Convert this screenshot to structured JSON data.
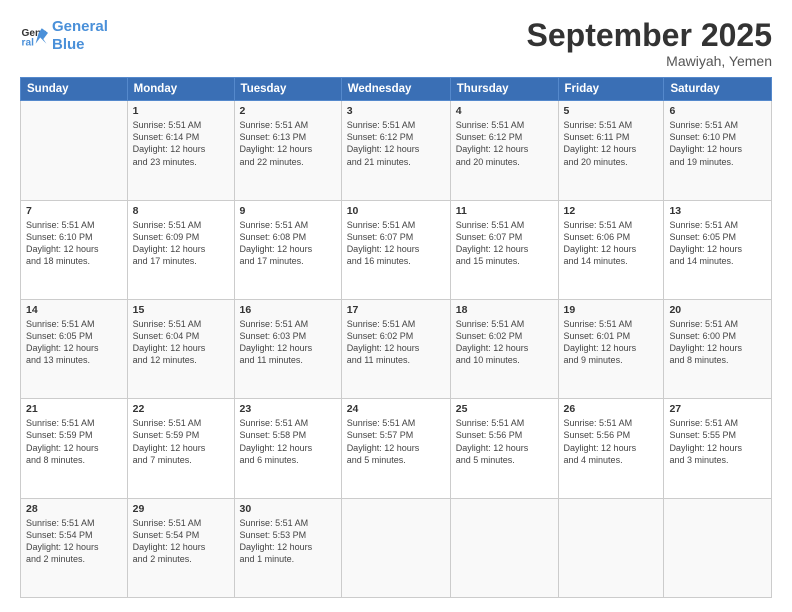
{
  "header": {
    "logo_line1": "General",
    "logo_line2": "Blue",
    "title": "September 2025",
    "subtitle": "Mawiyah, Yemen"
  },
  "columns": [
    "Sunday",
    "Monday",
    "Tuesday",
    "Wednesday",
    "Thursday",
    "Friday",
    "Saturday"
  ],
  "weeks": [
    [
      {
        "day": "",
        "content": ""
      },
      {
        "day": "1",
        "content": "Sunrise: 5:51 AM\nSunset: 6:14 PM\nDaylight: 12 hours\nand 23 minutes."
      },
      {
        "day": "2",
        "content": "Sunrise: 5:51 AM\nSunset: 6:13 PM\nDaylight: 12 hours\nand 22 minutes."
      },
      {
        "day": "3",
        "content": "Sunrise: 5:51 AM\nSunset: 6:12 PM\nDaylight: 12 hours\nand 21 minutes."
      },
      {
        "day": "4",
        "content": "Sunrise: 5:51 AM\nSunset: 6:12 PM\nDaylight: 12 hours\nand 20 minutes."
      },
      {
        "day": "5",
        "content": "Sunrise: 5:51 AM\nSunset: 6:11 PM\nDaylight: 12 hours\nand 20 minutes."
      },
      {
        "day": "6",
        "content": "Sunrise: 5:51 AM\nSunset: 6:10 PM\nDaylight: 12 hours\nand 19 minutes."
      }
    ],
    [
      {
        "day": "7",
        "content": "Sunrise: 5:51 AM\nSunset: 6:10 PM\nDaylight: 12 hours\nand 18 minutes."
      },
      {
        "day": "8",
        "content": "Sunrise: 5:51 AM\nSunset: 6:09 PM\nDaylight: 12 hours\nand 17 minutes."
      },
      {
        "day": "9",
        "content": "Sunrise: 5:51 AM\nSunset: 6:08 PM\nDaylight: 12 hours\nand 17 minutes."
      },
      {
        "day": "10",
        "content": "Sunrise: 5:51 AM\nSunset: 6:07 PM\nDaylight: 12 hours\nand 16 minutes."
      },
      {
        "day": "11",
        "content": "Sunrise: 5:51 AM\nSunset: 6:07 PM\nDaylight: 12 hours\nand 15 minutes."
      },
      {
        "day": "12",
        "content": "Sunrise: 5:51 AM\nSunset: 6:06 PM\nDaylight: 12 hours\nand 14 minutes."
      },
      {
        "day": "13",
        "content": "Sunrise: 5:51 AM\nSunset: 6:05 PM\nDaylight: 12 hours\nand 14 minutes."
      }
    ],
    [
      {
        "day": "14",
        "content": "Sunrise: 5:51 AM\nSunset: 6:05 PM\nDaylight: 12 hours\nand 13 minutes."
      },
      {
        "day": "15",
        "content": "Sunrise: 5:51 AM\nSunset: 6:04 PM\nDaylight: 12 hours\nand 12 minutes."
      },
      {
        "day": "16",
        "content": "Sunrise: 5:51 AM\nSunset: 6:03 PM\nDaylight: 12 hours\nand 11 minutes."
      },
      {
        "day": "17",
        "content": "Sunrise: 5:51 AM\nSunset: 6:02 PM\nDaylight: 12 hours\nand 11 minutes."
      },
      {
        "day": "18",
        "content": "Sunrise: 5:51 AM\nSunset: 6:02 PM\nDaylight: 12 hours\nand 10 minutes."
      },
      {
        "day": "19",
        "content": "Sunrise: 5:51 AM\nSunset: 6:01 PM\nDaylight: 12 hours\nand 9 minutes."
      },
      {
        "day": "20",
        "content": "Sunrise: 5:51 AM\nSunset: 6:00 PM\nDaylight: 12 hours\nand 8 minutes."
      }
    ],
    [
      {
        "day": "21",
        "content": "Sunrise: 5:51 AM\nSunset: 5:59 PM\nDaylight: 12 hours\nand 8 minutes."
      },
      {
        "day": "22",
        "content": "Sunrise: 5:51 AM\nSunset: 5:59 PM\nDaylight: 12 hours\nand 7 minutes."
      },
      {
        "day": "23",
        "content": "Sunrise: 5:51 AM\nSunset: 5:58 PM\nDaylight: 12 hours\nand 6 minutes."
      },
      {
        "day": "24",
        "content": "Sunrise: 5:51 AM\nSunset: 5:57 PM\nDaylight: 12 hours\nand 5 minutes."
      },
      {
        "day": "25",
        "content": "Sunrise: 5:51 AM\nSunset: 5:56 PM\nDaylight: 12 hours\nand 5 minutes."
      },
      {
        "day": "26",
        "content": "Sunrise: 5:51 AM\nSunset: 5:56 PM\nDaylight: 12 hours\nand 4 minutes."
      },
      {
        "day": "27",
        "content": "Sunrise: 5:51 AM\nSunset: 5:55 PM\nDaylight: 12 hours\nand 3 minutes."
      }
    ],
    [
      {
        "day": "28",
        "content": "Sunrise: 5:51 AM\nSunset: 5:54 PM\nDaylight: 12 hours\nand 2 minutes."
      },
      {
        "day": "29",
        "content": "Sunrise: 5:51 AM\nSunset: 5:54 PM\nDaylight: 12 hours\nand 2 minutes."
      },
      {
        "day": "30",
        "content": "Sunrise: 5:51 AM\nSunset: 5:53 PM\nDaylight: 12 hours\nand 1 minute."
      },
      {
        "day": "",
        "content": ""
      },
      {
        "day": "",
        "content": ""
      },
      {
        "day": "",
        "content": ""
      },
      {
        "day": "",
        "content": ""
      }
    ]
  ]
}
